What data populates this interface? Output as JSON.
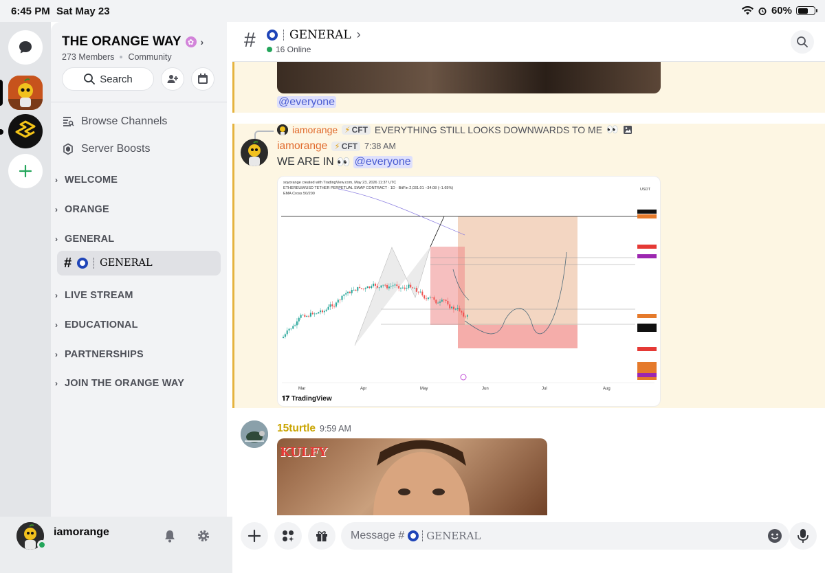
{
  "status_bar": {
    "time": "6:45 PM",
    "date": "Sat May 23",
    "battery": "60%",
    "battery_level": 0.6
  },
  "rail": {
    "icons": [
      "chat-bubble-icon",
      "orange-server-icon",
      "yellow-server-icon",
      "add-server-icon"
    ]
  },
  "server": {
    "name": "THE ORANGE WAY",
    "members": "273 Members",
    "type": "Community",
    "search_label": "Search",
    "browse_channels": "Browse Channels",
    "server_boosts": "Server Boosts",
    "categories": [
      "WELCOME",
      "ORANGE",
      "GENERAL",
      "LIVE STREAM",
      "EDUCATIONAL",
      "PARTNERSHIPS",
      "JOIN THE ORANGE WAY"
    ],
    "active_channel": "GENERAL"
  },
  "user": {
    "name": "iamorange",
    "status_color": "#23a55a"
  },
  "channel_header": {
    "hash": "#",
    "name": "GENERAL",
    "online": "16 Online"
  },
  "messages": {
    "prev_mention": "@everyone",
    "reply": {
      "author": "iamorange",
      "tag": "CFT",
      "text": "EVERYTHING STILL LOOKS DOWNWARDS TO ME",
      "emoji": "👀"
    },
    "msg1": {
      "author": "iamorange",
      "tag": "CFT",
      "time": "7:38 AM",
      "text": "WE ARE IN",
      "emoji": "👀",
      "mention": "@everyone"
    },
    "chart": {
      "created_line": "soyorange created with TradingView.com, May 23, 2026 11:37 UTC",
      "symbol_line": "ETHEREUM/USD TETHER PERPETUAL SWAP CONTRACT · 1D · BitFin  2,031.01  −34.08 (−1.65%)",
      "indicator": "EMA Cross 50/200",
      "currency": "USDT",
      "brand": "TradingView",
      "months": [
        "Mar",
        "Apr",
        "May",
        "Jun",
        "Jul",
        "Aug"
      ]
    },
    "msg2": {
      "author": "15turtle",
      "time": "9:59 AM",
      "gif_text": "KULFY"
    }
  },
  "composer": {
    "placeholder_prefix": "Message #",
    "placeholder_channel": "GENERAL"
  },
  "colors": {
    "accent_orange": "#e0692b",
    "mention_blue": "#4a5cd1",
    "highlight": "#fdf6e3",
    "highlight_bar": "#e5b33e",
    "online_green": "#23a55a",
    "turtle_name": "#c9a400"
  }
}
